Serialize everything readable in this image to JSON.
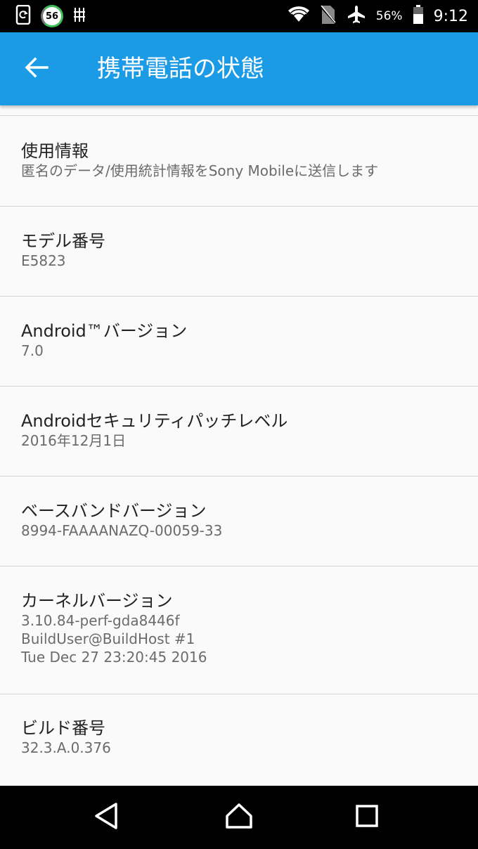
{
  "status_bar": {
    "notif_badge": "56",
    "battery_percent": "56%",
    "time": "9:12",
    "icons": [
      "screenshot-icon",
      "data-usage-icon",
      "usb-debug-icon",
      "wifi-icon",
      "no-sim-icon",
      "airplane-icon",
      "battery-icon"
    ]
  },
  "app_bar": {
    "title": "携帯電話の状態",
    "background_color": "#1b9ae6"
  },
  "items": [
    {
      "title": "使用情報",
      "subtitle": "匿名のデータ/使用統計情報をSony Mobileに送信します"
    },
    {
      "title": "モデル番号",
      "subtitle": "E5823"
    },
    {
      "title": "Android™バージョン",
      "subtitle": "7.0"
    },
    {
      "title": "Androidセキュリティパッチレベル",
      "subtitle": "2016年12月1日"
    },
    {
      "title": "ベースバンドバージョン",
      "subtitle": "8994-FAAAANAZQ-00059-33"
    },
    {
      "title": "カーネルバージョン",
      "subtitle": "3.10.84-perf-gda8446f\nBuildUser@BuildHost #1\nTue Dec 27 23:20:45 2016"
    },
    {
      "title": "ビルド番号",
      "subtitle": "32.3.A.0.376"
    }
  ],
  "nav_bar": {
    "icons": [
      "back-icon",
      "home-icon",
      "recents-icon"
    ]
  }
}
